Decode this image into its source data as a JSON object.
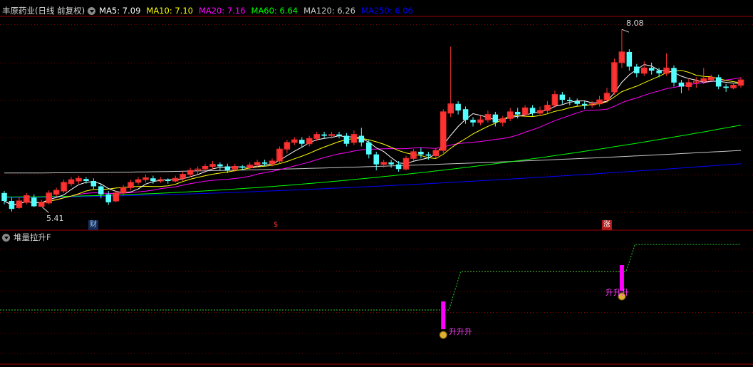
{
  "header": {
    "stock_label": "丰原药业(日线 前复权)",
    "ma": [
      {
        "label": "MA5: 7.09",
        "color": "#ffffff"
      },
      {
        "label": "MA10: 7.10",
        "color": "#ffff00"
      },
      {
        "label": "MA20: 7.16",
        "color": "#ff00ff"
      },
      {
        "label": "MA60: 6.64",
        "color": "#00ff00"
      },
      {
        "label": "MA120: 6.26",
        "color": "#c8c8c8"
      },
      {
        "label": "MA250: 6.06",
        "color": "#0000ff"
      }
    ]
  },
  "indicator": {
    "name": "堆量拉升F",
    "signal_label": "升升升"
  },
  "annotations": {
    "high_label": "8.08",
    "low_label": "5.41"
  },
  "markers": {
    "cai": "财",
    "dollar": "$",
    "zhang": "涨"
  },
  "chart_data": {
    "type": "candlestick",
    "candles": [
      [
        5.62,
        5.5,
        5.65,
        5.45
      ],
      [
        5.5,
        5.38,
        5.55,
        5.34
      ],
      [
        5.4,
        5.5,
        5.56,
        5.38
      ],
      [
        5.48,
        5.58,
        5.62,
        5.45
      ],
      [
        5.55,
        5.42,
        5.6,
        5.41
      ],
      [
        5.42,
        5.48,
        5.52,
        5.41
      ],
      [
        5.47,
        5.62,
        5.66,
        5.45
      ],
      [
        5.6,
        5.66,
        5.7,
        5.56
      ],
      [
        5.65,
        5.78,
        5.82,
        5.62
      ],
      [
        5.76,
        5.82,
        5.86,
        5.72
      ],
      [
        5.8,
        5.84,
        5.88,
        5.76
      ],
      [
        5.83,
        5.8,
        5.86,
        5.76
      ],
      [
        5.8,
        5.72,
        5.84,
        5.68
      ],
      [
        5.72,
        5.6,
        5.76,
        5.54
      ],
      [
        5.6,
        5.48,
        5.65,
        5.44
      ],
      [
        5.5,
        5.62,
        5.66,
        5.48
      ],
      [
        5.62,
        5.7,
        5.74,
        5.58
      ],
      [
        5.7,
        5.78,
        5.82,
        5.66
      ],
      [
        5.78,
        5.82,
        5.86,
        5.74
      ],
      [
        5.82,
        5.85,
        5.9,
        5.78
      ],
      [
        5.84,
        5.8,
        5.88,
        5.76
      ],
      [
        5.8,
        5.82,
        5.86,
        5.77
      ],
      [
        5.82,
        5.8,
        5.84,
        5.76
      ],
      [
        5.8,
        5.84,
        5.88,
        5.78
      ],
      [
        5.84,
        5.9,
        5.94,
        5.8
      ],
      [
        5.9,
        5.96,
        6.0,
        5.86
      ],
      [
        5.96,
        5.98,
        6.02,
        5.9
      ],
      [
        5.98,
        6.02,
        6.06,
        5.94
      ],
      [
        6.02,
        6.05,
        6.1,
        5.98
      ],
      [
        6.05,
        6.02,
        6.08,
        5.96
      ],
      [
        6.02,
        5.96,
        6.06,
        5.92
      ],
      [
        5.98,
        6.02,
        6.06,
        5.94
      ],
      [
        6.02,
        6.0,
        6.04,
        5.96
      ],
      [
        6.0,
        6.04,
        6.08,
        5.96
      ],
      [
        6.04,
        6.08,
        6.12,
        6.0
      ],
      [
        6.08,
        6.06,
        6.12,
        6.02
      ],
      [
        6.06,
        6.1,
        6.14,
        6.02
      ],
      [
        6.1,
        6.28,
        6.32,
        6.06
      ],
      [
        6.28,
        6.38,
        6.42,
        6.22
      ],
      [
        6.38,
        6.42,
        6.46,
        6.34
      ],
      [
        6.42,
        6.36,
        6.46,
        6.3
      ],
      [
        6.36,
        6.44,
        6.48,
        6.32
      ],
      [
        6.44,
        6.5,
        6.54,
        6.4
      ],
      [
        6.5,
        6.48,
        6.54,
        6.44
      ],
      [
        6.48,
        6.5,
        6.54,
        6.44
      ],
      [
        6.5,
        6.48,
        6.54,
        6.44
      ],
      [
        6.48,
        6.36,
        6.52,
        6.32
      ],
      [
        6.38,
        6.5,
        6.56,
        6.34
      ],
      [
        6.48,
        6.38,
        6.6,
        6.32
      ],
      [
        6.38,
        6.2,
        6.42,
        6.14
      ],
      [
        6.2,
        6.05,
        6.24,
        5.96
      ],
      [
        6.05,
        6.08,
        6.12,
        6.0
      ],
      [
        6.08,
        6.05,
        6.12,
        6.0
      ],
      [
        6.05,
        5.98,
        6.1,
        5.94
      ],
      [
        5.98,
        6.14,
        6.18,
        5.96
      ],
      [
        6.14,
        6.24,
        6.28,
        6.1
      ],
      [
        6.24,
        6.2,
        6.3,
        6.14
      ],
      [
        6.2,
        6.18,
        6.24,
        6.12
      ],
      [
        6.18,
        6.26,
        6.3,
        6.14
      ],
      [
        6.26,
        6.84,
        6.88,
        6.22
      ],
      [
        6.82,
        6.96,
        7.82,
        6.76
      ],
      [
        6.96,
        6.86,
        7.0,
        6.8
      ],
      [
        6.88,
        6.72,
        6.92,
        6.66
      ],
      [
        6.72,
        6.68,
        6.76,
        6.62
      ],
      [
        6.68,
        6.72,
        6.78,
        6.64
      ],
      [
        6.72,
        6.8,
        6.86,
        6.68
      ],
      [
        6.8,
        6.68,
        6.84,
        6.62
      ],
      [
        6.68,
        6.74,
        6.78,
        6.62
      ],
      [
        6.74,
        6.84,
        6.9,
        6.7
      ],
      [
        6.84,
        6.8,
        6.9,
        6.74
      ],
      [
        6.8,
        6.9,
        6.94,
        6.76
      ],
      [
        6.9,
        6.82,
        6.94,
        6.78
      ],
      [
        6.82,
        6.86,
        6.92,
        6.78
      ],
      [
        6.86,
        6.94,
        7.0,
        6.82
      ],
      [
        6.94,
        7.1,
        7.16,
        6.9
      ],
      [
        7.1,
        7.02,
        7.14,
        6.96
      ],
      [
        7.02,
        7.0,
        7.06,
        6.94
      ],
      [
        7.0,
        6.96,
        7.04,
        6.92
      ],
      [
        6.96,
        6.94,
        7.0,
        6.88
      ],
      [
        6.94,
        6.96,
        7.0,
        6.9
      ],
      [
        6.96,
        7.02,
        7.08,
        6.92
      ],
      [
        7.02,
        7.12,
        7.2,
        6.98
      ],
      [
        7.14,
        7.58,
        7.64,
        7.1
      ],
      [
        7.58,
        7.74,
        8.08,
        7.5
      ],
      [
        7.74,
        7.52,
        7.78,
        7.46
      ],
      [
        7.52,
        7.42,
        7.56,
        7.36
      ],
      [
        7.42,
        7.5,
        7.6,
        7.38
      ],
      [
        7.5,
        7.46,
        7.58,
        7.4
      ],
      [
        7.46,
        7.42,
        7.5,
        7.36
      ],
      [
        7.42,
        7.5,
        7.72,
        7.38
      ],
      [
        7.5,
        7.28,
        7.54,
        7.22
      ],
      [
        7.28,
        7.22,
        7.32,
        7.12
      ],
      [
        7.22,
        7.28,
        7.34,
        7.16
      ],
      [
        7.28,
        7.3,
        7.36,
        7.2
      ],
      [
        7.3,
        7.34,
        7.5,
        7.26
      ],
      [
        7.32,
        7.36,
        7.4,
        7.3
      ],
      [
        7.36,
        7.22,
        7.4,
        7.18
      ],
      [
        7.22,
        7.2,
        7.26,
        7.14
      ],
      [
        7.2,
        7.24,
        7.28,
        7.18
      ],
      [
        7.24,
        7.32,
        7.36,
        7.2
      ]
    ],
    "ma_values": {
      "MA60_start_end": [
        5.56,
        6.64
      ],
      "MA120_start_end": [
        5.92,
        6.26
      ],
      "MA250_start_end": [
        5.55,
        6.06
      ]
    },
    "indicator_signals": [
      {
        "index": 59,
        "value": "升升升"
      },
      {
        "index": 83,
        "value": "升升升"
      }
    ],
    "step_line_levels": [
      1,
      2,
      3,
      4
    ]
  }
}
